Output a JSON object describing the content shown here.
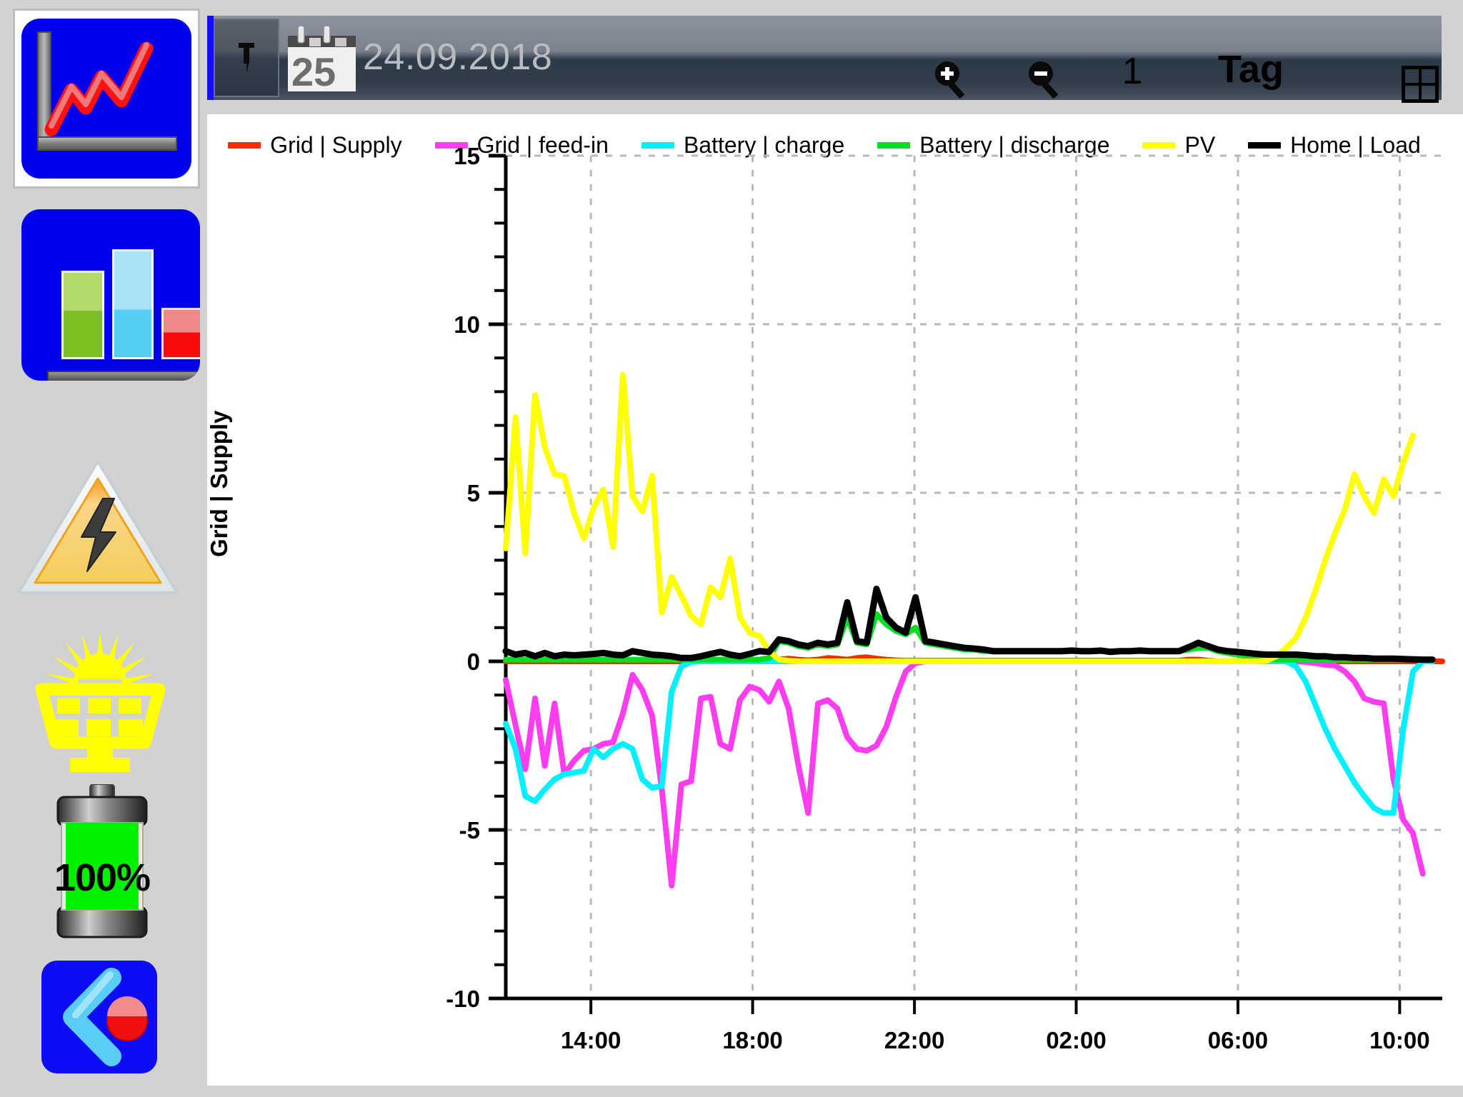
{
  "sidebar": {
    "items": [
      {
        "name": "trend-chart-view",
        "label": "Trend chart",
        "selected": true
      },
      {
        "name": "bar-chart-view",
        "label": "Bar chart",
        "selected": false
      },
      {
        "name": "grid-power-warning",
        "label": "Grid power",
        "selected": false
      },
      {
        "name": "pv-production",
        "label": "PV production",
        "selected": false
      },
      {
        "name": "battery-status",
        "label": "Battery",
        "selected": false
      },
      {
        "name": "back-button",
        "label": "Back",
        "selected": false
      }
    ],
    "battery_percent": "100%"
  },
  "toolbar": {
    "pin_icon": "pin-icon",
    "calendar_icon": "calendar-icon",
    "calendar_day": "25",
    "date": "24.09.2018",
    "zoom_in_icon": "zoom-in-icon",
    "zoom_out_icon": "zoom-out-icon",
    "interval_count": "1",
    "interval_unit": "Tag",
    "grid_view_icon": "grid-view-icon",
    "menu_icon": "hamburger-menu-icon"
  },
  "chart_data": {
    "type": "line",
    "title": "",
    "xlabel": "",
    "ylabel": "Grid | Supply",
    "ylim": [
      -10,
      15
    ],
    "yticks": [
      15,
      10,
      5,
      0,
      -5,
      -10
    ],
    "yminor_step": 1,
    "grid": true,
    "legend_position": "top",
    "xlim_labels": [
      "12:00",
      "11:30"
    ],
    "xticks": [
      "14:00",
      "18:00",
      "22:00",
      "02:00",
      "06:00",
      "10:00"
    ],
    "xtick_positions": [
      0.0909,
      0.2636,
      0.4364,
      0.6091,
      0.7818,
      0.9545
    ],
    "colors": {
      "grid_supply": "#ff2a00",
      "grid_feedin": "#ff3cf0",
      "battery_charge": "#00f0ff",
      "battery_discharge": "#00e020",
      "pv": "#ffff00",
      "home_load": "#000000"
    },
    "series": [
      {
        "name": "Grid | Supply",
        "color": "#ff2a00",
        "values": [
          0,
          0,
          0,
          0,
          0,
          0,
          0,
          0,
          0,
          0,
          0,
          0,
          0,
          0,
          0,
          0,
          0,
          0,
          0,
          0,
          0,
          0,
          0,
          0,
          0,
          0,
          0,
          0,
          0.05,
          0.08,
          0.05,
          0.03,
          0.05,
          0.1,
          0.08,
          0.05,
          0.1,
          0.12,
          0.08,
          0.05,
          0.03,
          0.02,
          0.02,
          0.02,
          0.02,
          0.02,
          0.02,
          0.02,
          0.02,
          0.02,
          0.02,
          0.02,
          0.02,
          0.02,
          0.02,
          0.02,
          0.02,
          0.02,
          0.02,
          0.02,
          0.02,
          0.02,
          0.02,
          0.02,
          0.02,
          0.02,
          0.02,
          0.02,
          0.02,
          0.02,
          0.05,
          0.05,
          0.02,
          0,
          0,
          0,
          0,
          0,
          0,
          0,
          0,
          0,
          0,
          0,
          0,
          0,
          0,
          0,
          0,
          0,
          0,
          0,
          0,
          0,
          0,
          0,
          0
        ]
      },
      {
        "name": "Grid | feed-in",
        "color": "#ff3cf0",
        "values": [
          -0.55,
          -1.9,
          -3.2,
          -1.1,
          -3.1,
          -1.25,
          -3.35,
          -2.95,
          -2.65,
          -2.6,
          -2.45,
          -2.4,
          -1.55,
          -0.4,
          -0.85,
          -1.6,
          -3.8,
          -6.65,
          -3.65,
          -3.55,
          -1.1,
          -1.05,
          -2.45,
          -2.6,
          -1.15,
          -0.75,
          -0.85,
          -1.2,
          -0.6,
          -1.4,
          -3.1,
          -4.5,
          -1.25,
          -1.15,
          -1.4,
          -2.25,
          -2.6,
          -2.65,
          -2.5,
          -1.95,
          -1.05,
          -0.3,
          -0.05,
          0,
          0,
          0,
          0,
          0,
          0,
          0,
          0,
          0,
          0,
          0,
          0,
          0,
          0,
          0,
          0,
          0,
          0,
          0,
          0,
          0,
          0,
          0,
          0,
          0,
          0,
          0,
          0,
          0,
          0,
          0,
          0,
          0,
          0,
          0,
          0,
          0,
          0,
          0,
          -0.02,
          -0.05,
          -0.1,
          -0.12,
          -0.3,
          -0.6,
          -1.1,
          -1.2,
          -1.25,
          -3.5,
          -4.7,
          -5.1,
          -6.3
        ]
      },
      {
        "name": "Battery | charge",
        "color": "#00f0ff",
        "values": [
          -1.85,
          -2.6,
          -4.0,
          -4.15,
          -3.8,
          -3.5,
          -3.35,
          -3.3,
          -3.25,
          -2.6,
          -2.85,
          -2.6,
          -2.45,
          -2.6,
          -3.5,
          -3.75,
          -3.7,
          -0.9,
          -0.15,
          -0.02,
          0,
          0,
          0,
          0,
          0,
          0,
          0,
          0,
          0,
          0,
          0,
          0,
          0,
          0,
          0,
          0,
          0,
          0,
          0,
          0,
          0,
          0,
          0,
          0,
          0,
          0,
          0,
          0,
          0,
          0,
          0,
          0,
          0,
          0,
          0,
          0,
          0,
          0,
          0,
          0,
          0,
          0,
          0,
          0,
          0,
          0,
          0,
          0,
          0,
          0,
          0,
          0,
          0,
          0,
          0,
          0,
          0,
          0,
          0,
          0,
          0,
          -0.15,
          -0.6,
          -1.3,
          -2.0,
          -2.6,
          -3.1,
          -3.6,
          -4.0,
          -4.35,
          -4.5,
          -4.5,
          -2.0,
          -0.3,
          0,
          0
        ]
      },
      {
        "name": "Battery | discharge",
        "color": "#00e020",
        "values": [
          0.05,
          0.05,
          0.05,
          0.05,
          0.05,
          0.05,
          0.05,
          0.05,
          0.05,
          0.05,
          0.05,
          0.05,
          0.05,
          0.05,
          0.05,
          0.05,
          0.05,
          0.05,
          0.05,
          0.05,
          0.05,
          0.05,
          0.05,
          0.05,
          0.05,
          0.05,
          0.05,
          0.1,
          0.6,
          0.55,
          0.45,
          0.4,
          0.5,
          0.45,
          0.5,
          1.3,
          0.55,
          0.5,
          1.4,
          1.1,
          0.9,
          0.8,
          1.0,
          0.55,
          0.5,
          0.45,
          0.4,
          0.35,
          0.35,
          0.3,
          0.3,
          0.3,
          0.3,
          0.3,
          0.3,
          0.3,
          0.3,
          0.3,
          0.3,
          0.3,
          0.3,
          0.3,
          0.3,
          0.3,
          0.3,
          0.3,
          0.3,
          0.3,
          0.3,
          0.3,
          0.35,
          0.4,
          0.4,
          0.3,
          0.25,
          0.2,
          0.15,
          0.1,
          0.08,
          0.05,
          0.05,
          0.05,
          0.05,
          0.05,
          0.05,
          0.05,
          0.05,
          0.05,
          0.05,
          0.05,
          0.05,
          0.05,
          0.05,
          0.05,
          0.05,
          0.05
        ]
      },
      {
        "name": "PV",
        "color": "#ffff00",
        "values": [
          3.35,
          7.25,
          3.2,
          7.9,
          6.35,
          5.55,
          5.5,
          4.4,
          3.65,
          4.55,
          5.1,
          3.4,
          8.5,
          4.9,
          4.45,
          5.5,
          1.45,
          2.5,
          1.95,
          1.35,
          1.1,
          2.2,
          1.9,
          3.05,
          1.3,
          0.85,
          0.75,
          0.3,
          0.05,
          0.02,
          0,
          0,
          0,
          0,
          0,
          0,
          0,
          0,
          0,
          0,
          0,
          0,
          0,
          0,
          0,
          0,
          0,
          0,
          0,
          0,
          0,
          0,
          0,
          0,
          0,
          0,
          0,
          0,
          0,
          0,
          0,
          0,
          0,
          0,
          0,
          0,
          0,
          0,
          0,
          0,
          0,
          0,
          0,
          0,
          0,
          0,
          0,
          0,
          0.02,
          0.15,
          0.4,
          0.7,
          1.3,
          2.1,
          3.0,
          3.8,
          4.5,
          5.55,
          4.9,
          4.4,
          5.4,
          4.9,
          5.9,
          6.7
        ]
      },
      {
        "name": "Home | Load",
        "color": "#000000",
        "values": [
          0.3,
          0.2,
          0.25,
          0.15,
          0.25,
          0.15,
          0.2,
          0.18,
          0.2,
          0.22,
          0.25,
          0.2,
          0.18,
          0.3,
          0.25,
          0.2,
          0.18,
          0.15,
          0.1,
          0.1,
          0.15,
          0.22,
          0.28,
          0.2,
          0.15,
          0.22,
          0.3,
          0.28,
          0.65,
          0.6,
          0.5,
          0.45,
          0.55,
          0.5,
          0.55,
          1.75,
          0.6,
          0.55,
          2.15,
          1.3,
          1.0,
          0.85,
          1.9,
          0.6,
          0.55,
          0.5,
          0.45,
          0.4,
          0.38,
          0.35,
          0.3,
          0.3,
          0.3,
          0.3,
          0.3,
          0.3,
          0.3,
          0.3,
          0.32,
          0.3,
          0.3,
          0.32,
          0.28,
          0.3,
          0.3,
          0.32,
          0.3,
          0.3,
          0.3,
          0.3,
          0.42,
          0.55,
          0.45,
          0.35,
          0.3,
          0.28,
          0.25,
          0.22,
          0.2,
          0.2,
          0.2,
          0.2,
          0.18,
          0.15,
          0.15,
          0.12,
          0.12,
          0.1,
          0.1,
          0.08,
          0.08,
          0.08,
          0.07,
          0.06,
          0.05,
          0.05
        ]
      }
    ]
  }
}
